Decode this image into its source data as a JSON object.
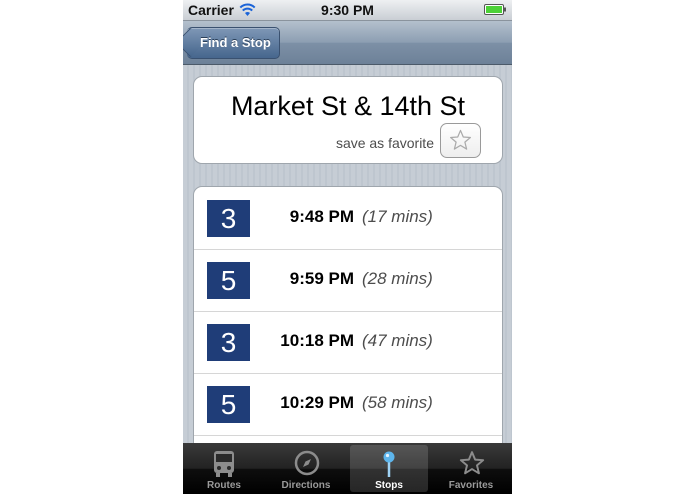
{
  "status_bar": {
    "carrier": "Carrier",
    "time": "9:30 PM"
  },
  "nav": {
    "back_label": "Find a Stop"
  },
  "stop": {
    "name": "Market St & 14th St",
    "favorite_label": "save as favorite"
  },
  "arrivals": [
    {
      "route": "3",
      "time": "9:48 PM",
      "wait": "(17 mins)"
    },
    {
      "route": "5",
      "time": "9:59 PM",
      "wait": "(28 mins)"
    },
    {
      "route": "3",
      "time": "10:18 PM",
      "wait": "(47 mins)"
    },
    {
      "route": "5",
      "time": "10:29 PM",
      "wait": "(58 mins)"
    }
  ],
  "tabs": [
    {
      "label": "Routes",
      "icon": "bus-icon"
    },
    {
      "label": "Directions",
      "icon": "compass-icon"
    },
    {
      "label": "Stops",
      "icon": "pin-icon",
      "selected": true
    },
    {
      "label": "Favorites",
      "icon": "star-icon"
    }
  ],
  "colors": {
    "route_badge": "#1f3d78",
    "battery": "#4cd137"
  }
}
